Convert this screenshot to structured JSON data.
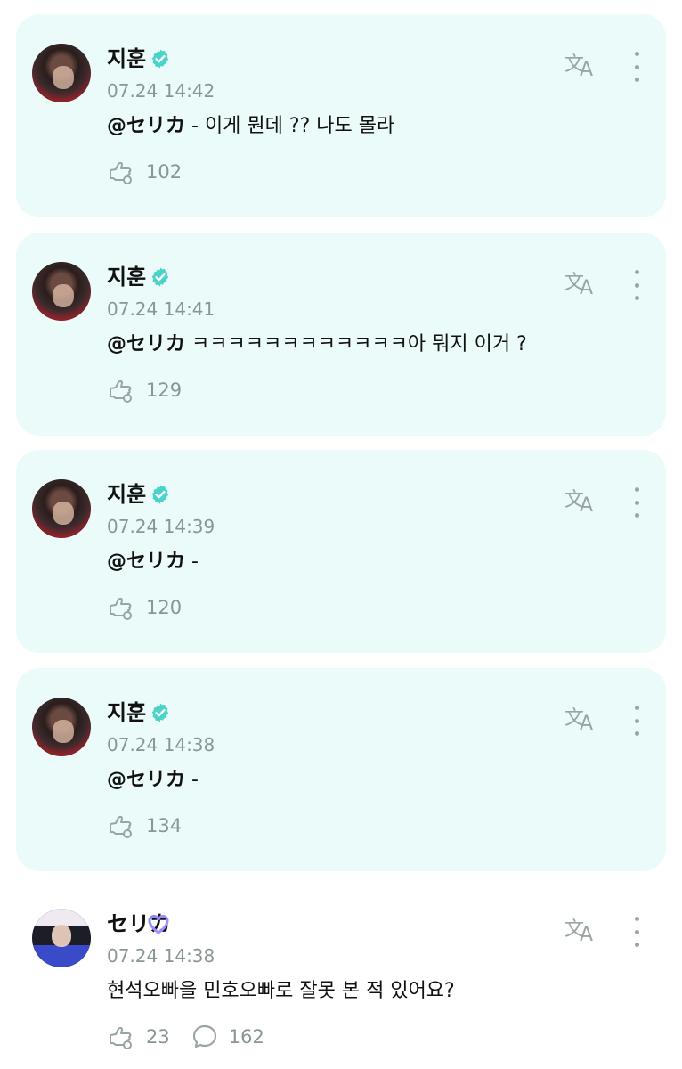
{
  "posts": [
    {
      "name": "지훈",
      "time": "07.24 14:42",
      "mention": "@セリカ",
      "text": " - 이게 뭔데 ?? 나도 몰라",
      "likes": "102",
      "verified": true
    },
    {
      "name": "지훈",
      "time": "07.24 14:41",
      "mention": "@セリカ",
      "text": " ㅋㅋㅋㅋㅋㅋㅋㅋㅋㅋㅋㅋ아 뭐지 이거 ?",
      "likes": "129",
      "verified": true
    },
    {
      "name": "지훈",
      "time": "07.24 14:39",
      "mention": "@セリカ",
      "text": " -",
      "likes": "120",
      "verified": true
    },
    {
      "name": "지훈",
      "time": "07.24 14:38",
      "mention": "@セリカ",
      "text": " -",
      "likes": "134",
      "verified": true
    }
  ],
  "reply": {
    "name": "セリカ",
    "time": "07.24 14:38",
    "text": "현석오빠을 민호오빠로 잘못 본 적 있어요?",
    "likes": "23",
    "comments": "162"
  },
  "colors": {
    "card_bg": "#eafbf9",
    "badge": "#49d3c9",
    "heart_start": "#7f8cff",
    "heart_end": "#b58cff",
    "muted": "#8a9596"
  },
  "icons": {
    "verified": "verified-check-icon",
    "translate": "translate-icon",
    "more": "more-vertical-icon",
    "like": "like-hand-icon",
    "comment": "comment-bubble-icon",
    "heart": "heart-badge-icon"
  }
}
